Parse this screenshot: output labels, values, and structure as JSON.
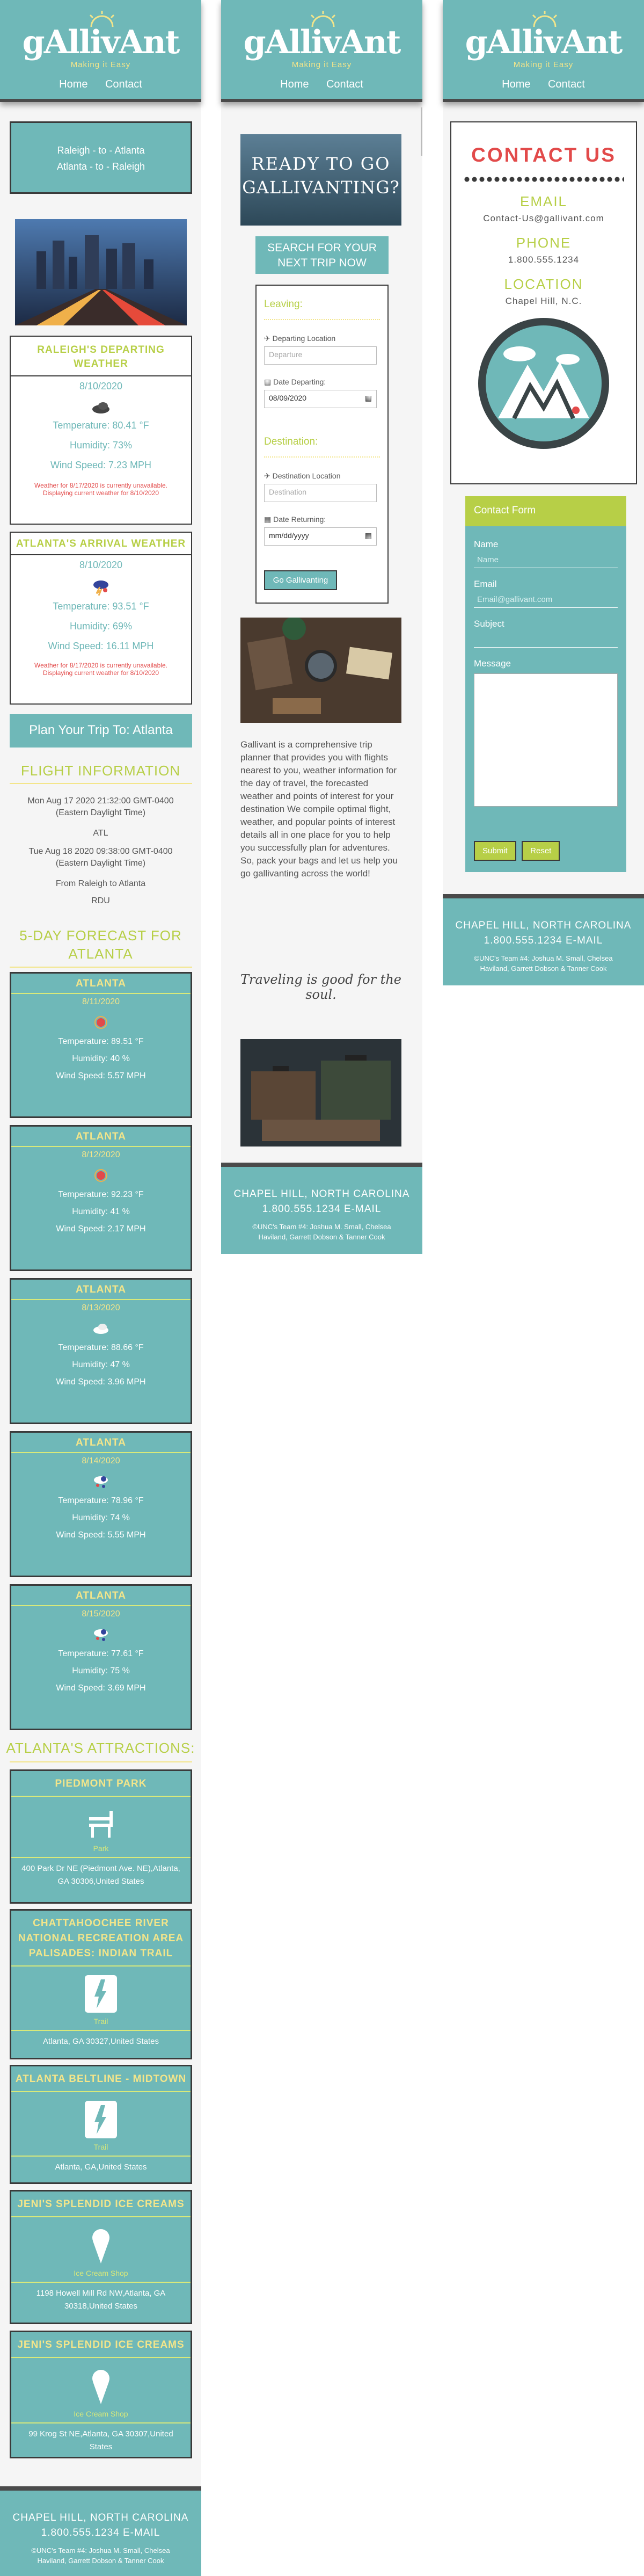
{
  "brand": {
    "logo": "gAllivAnt",
    "tagline": "Making it Easy",
    "nav": [
      "Home",
      "Contact"
    ]
  },
  "colors": {
    "teal": "#6fb8b8",
    "lime": "#b7cf47",
    "yellow": "#f3e58a",
    "dark": "#3a3a3a",
    "red": "#e24a4a"
  },
  "col1": {
    "route": {
      "line1": "Raleigh - to - Atlanta",
      "line2": "Atlanta - to - Raleigh"
    },
    "departing": {
      "title": "RALEIGH'S DEPARTING WEATHER",
      "date": "8/10/2020",
      "icon": "cloud-icon",
      "temperature": "Temperature: 80.41 °F",
      "humidity": "Humidity: 73%",
      "wind": "Wind Speed: 7.23 MPH",
      "warn1": "Weather for 8/17/2020 is currently unavailable.",
      "warn2": "Displaying current weather for 8/10/2020"
    },
    "arrival": {
      "title": "ATLANTA'S ARRIVAL WEATHER",
      "date": "8/10/2020",
      "icon": "thunderstorm-icon",
      "temperature": "Temperature: 93.51 °F",
      "humidity": "Humidity: 69%",
      "wind": "Wind Speed: 16.11 MPH",
      "warn1": "Weather for 8/17/2020 is currently unavailable.",
      "warn2": "Displaying current weather for 8/10/2020"
    },
    "plan_title": "Plan Your Trip To: Atlanta",
    "flight": {
      "heading": "FLIGHT INFORMATION",
      "dep_time": "Mon Aug 17 2020 21:32:00 GMT-0400",
      "dep_tz": "(Eastern Daylight Time)",
      "dep_code": "ATL",
      "arr_time": "Tue Aug 18 2020 09:38:00 GMT-0400",
      "arr_tz": "(Eastern Daylight Time)",
      "from": "From Raleigh to Atlanta",
      "code": "RDU"
    },
    "forecast_heading": "5-DAY FORECAST FOR ATLANTA",
    "forecast": [
      {
        "city": "ATLANTA",
        "date": "8/11/2020",
        "icon": "sun-icon",
        "temp": "Temperature: 89.51 °F",
        "hum": "Humidity: 40 %",
        "wind": "Wind Speed: 5.57 MPH"
      },
      {
        "city": "ATLANTA",
        "date": "8/12/2020",
        "icon": "sun-icon",
        "temp": "Temperature: 92.23 °F",
        "hum": "Humidity: 41 %",
        "wind": "Wind Speed: 2.17 MPH"
      },
      {
        "city": "ATLANTA",
        "date": "8/13/2020",
        "icon": "cloud-icon",
        "temp": "Temperature: 88.66 °F",
        "hum": "Humidity: 47 %",
        "wind": "Wind Speed: 3.96 MPH"
      },
      {
        "city": "ATLANTA",
        "date": "8/14/2020",
        "icon": "rain-icon",
        "temp": "Temperature: 78.96 °F",
        "hum": "Humidity: 74 %",
        "wind": "Wind Speed: 5.55 MPH"
      },
      {
        "city": "ATLANTA",
        "date": "8/15/2020",
        "icon": "rain-icon",
        "temp": "Temperature: 77.61 °F",
        "hum": "Humidity: 75 %",
        "wind": "Wind Speed: 3.69 MPH"
      }
    ],
    "attractions_heading": "ATLANTA'S ATTRACTIONS:",
    "attractions": [
      {
        "name": "PIEDMONT PARK",
        "category": "Park",
        "icon": "park-bench-icon",
        "address": "400 Park Dr NE (Piedmont Ave. NE),Atlanta, GA 30306,United States"
      },
      {
        "name": "CHATTAHOOCHEE RIVER NATIONAL RECREATION AREA PALISADES: INDIAN TRAIL",
        "category": "Trail",
        "icon": "hiking-icon",
        "address": "Atlanta, GA 30327,United States"
      },
      {
        "name": "ATLANTA BELTLINE - MIDTOWN",
        "category": "Trail",
        "icon": "hiking-icon",
        "address": "Atlanta, GA,United States"
      },
      {
        "name": "JENI'S SPLENDID ICE CREAMS",
        "category": "Ice Cream Shop",
        "icon": "ice-cream-icon",
        "address": "1198 Howell Mill Rd NW,Atlanta, GA 30318,United States"
      },
      {
        "name": "JENI'S SPLENDID ICE CREAMS",
        "category": "Ice Cream Shop",
        "icon": "ice-cream-icon",
        "address": "99 Krog St NE,Atlanta, GA 30307,United States"
      }
    ]
  },
  "col2": {
    "hero_text1": "READY TO GO",
    "hero_text2": "GALLIVANTING?",
    "search_title": "SEARCH FOR YOUR NEXT TRIP NOW",
    "leaving": "Leaving:",
    "departing_label": "Departing Location",
    "departing_placeholder": "Departure",
    "date_departing_label": "Date Departing:",
    "date_departing_value": "08/09/2020",
    "destination": "Destination:",
    "destination_label": "Destination Location",
    "destination_placeholder": "Destination",
    "date_returning_label": "Date Returning:",
    "date_returning_value": "mm/dd/yyyy",
    "go_button": "Go Gallivanting",
    "about": "Gallivant is a comprehensive trip planner that provides you with flights nearest to you, weather information for the day of travel, the forecasted weather and points of interest for your destination We compile optimal flight, weather, and popular points of interest details all in one place for you to help you successfully plan for adventures. So, pack your bags and let us help you go gallivanting across the world!",
    "quote": "Traveling is good for the soul."
  },
  "col3": {
    "contact_title": "CONTACT US",
    "email_label": "EMAIL",
    "email": "Contact-Us@gallivant.com",
    "phone_label": "PHONE",
    "phone": "1.800.555.1234",
    "location_label": "LOCATION",
    "location": "Chapel Hill, N.C.",
    "form_title": "Contact Form",
    "name_label": "Name",
    "name_placeholder": "Name",
    "email_field_label": "Email",
    "email_placeholder": "Email@gallivant.com",
    "subject_label": "Subject",
    "message_label": "Message",
    "submit": "Submit",
    "reset": "Reset"
  },
  "footer": {
    "line1": "CHAPEL HILL, NORTH CAROLINA",
    "line2": "1.800.555.1234 E-MAIL",
    "line3": "©UNC's Team #4: Joshua M. Small, Chelsea Haviland, Garrett Dobson & Tanner Cook"
  }
}
